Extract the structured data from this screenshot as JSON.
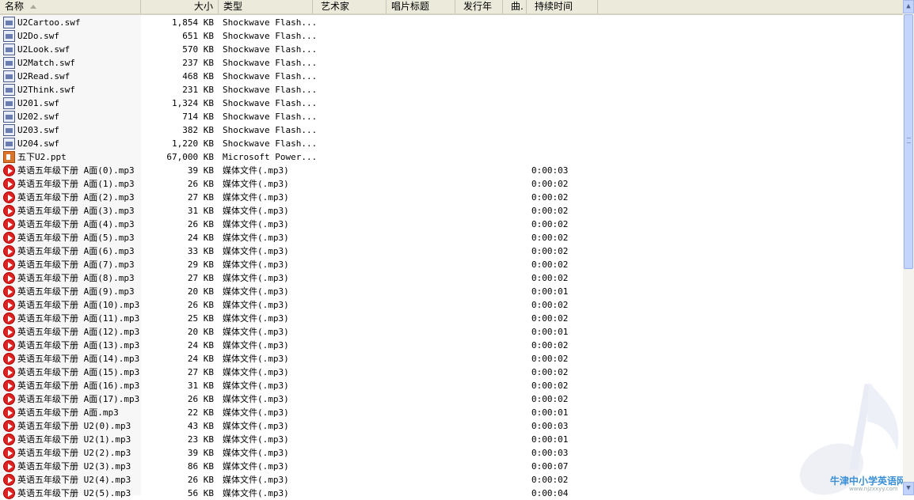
{
  "columns": {
    "name": "名称",
    "size": "大小",
    "type": "类型",
    "artist": "艺术家",
    "album": "唱片标题",
    "year": "发行年",
    "track": "曲.",
    "duration": "持续时间"
  },
  "sort": {
    "column": "name",
    "direction": "ascending"
  },
  "files": [
    {
      "name": "U2Cartoo.swf",
      "size": "1,854 KB",
      "type": "Shockwave Flash...",
      "duration": "",
      "icon": "swf-file-icon"
    },
    {
      "name": "U2Do.swf",
      "size": "651 KB",
      "type": "Shockwave Flash...",
      "duration": "",
      "icon": "swf-file-icon"
    },
    {
      "name": "U2Look.swf",
      "size": "570 KB",
      "type": "Shockwave Flash...",
      "duration": "",
      "icon": "swf-file-icon"
    },
    {
      "name": "U2Match.swf",
      "size": "237 KB",
      "type": "Shockwave Flash...",
      "duration": "",
      "icon": "swf-file-icon"
    },
    {
      "name": "U2Read.swf",
      "size": "468 KB",
      "type": "Shockwave Flash...",
      "duration": "",
      "icon": "swf-file-icon"
    },
    {
      "name": "U2Think.swf",
      "size": "231 KB",
      "type": "Shockwave Flash...",
      "duration": "",
      "icon": "swf-file-icon"
    },
    {
      "name": "U201.swf",
      "size": "1,324 KB",
      "type": "Shockwave Flash...",
      "duration": "",
      "icon": "swf-file-icon"
    },
    {
      "name": "U202.swf",
      "size": "714 KB",
      "type": "Shockwave Flash...",
      "duration": "",
      "icon": "swf-file-icon"
    },
    {
      "name": "U203.swf",
      "size": "382 KB",
      "type": "Shockwave Flash...",
      "duration": "",
      "icon": "swf-file-icon"
    },
    {
      "name": "U204.swf",
      "size": "1,220 KB",
      "type": "Shockwave Flash...",
      "duration": "",
      "icon": "swf-file-icon"
    },
    {
      "name": "五下U2.ppt",
      "size": "67,000 KB",
      "type": "Microsoft Power...",
      "duration": "",
      "icon": "ppt-file-icon"
    },
    {
      "name": "英语五年级下册 A面(0).mp3",
      "size": "39 KB",
      "type": "媒体文件(.mp3)",
      "duration": "0:00:03",
      "icon": "mp3-file-icon"
    },
    {
      "name": "英语五年级下册 A面(1).mp3",
      "size": "26 KB",
      "type": "媒体文件(.mp3)",
      "duration": "0:00:02",
      "icon": "mp3-file-icon"
    },
    {
      "name": "英语五年级下册 A面(2).mp3",
      "size": "27 KB",
      "type": "媒体文件(.mp3)",
      "duration": "0:00:02",
      "icon": "mp3-file-icon"
    },
    {
      "name": "英语五年级下册 A面(3).mp3",
      "size": "31 KB",
      "type": "媒体文件(.mp3)",
      "duration": "0:00:02",
      "icon": "mp3-file-icon"
    },
    {
      "name": "英语五年级下册 A面(4).mp3",
      "size": "26 KB",
      "type": "媒体文件(.mp3)",
      "duration": "0:00:02",
      "icon": "mp3-file-icon"
    },
    {
      "name": "英语五年级下册 A面(5).mp3",
      "size": "24 KB",
      "type": "媒体文件(.mp3)",
      "duration": "0:00:02",
      "icon": "mp3-file-icon"
    },
    {
      "name": "英语五年级下册 A面(6).mp3",
      "size": "33 KB",
      "type": "媒体文件(.mp3)",
      "duration": "0:00:02",
      "icon": "mp3-file-icon"
    },
    {
      "name": "英语五年级下册 A面(7).mp3",
      "size": "29 KB",
      "type": "媒体文件(.mp3)",
      "duration": "0:00:02",
      "icon": "mp3-file-icon"
    },
    {
      "name": "英语五年级下册 A面(8).mp3",
      "size": "27 KB",
      "type": "媒体文件(.mp3)",
      "duration": "0:00:02",
      "icon": "mp3-file-icon"
    },
    {
      "name": "英语五年级下册 A面(9).mp3",
      "size": "20 KB",
      "type": "媒体文件(.mp3)",
      "duration": "0:00:01",
      "icon": "mp3-file-icon"
    },
    {
      "name": "英语五年级下册 A面(10).mp3",
      "size": "26 KB",
      "type": "媒体文件(.mp3)",
      "duration": "0:00:02",
      "icon": "mp3-file-icon"
    },
    {
      "name": "英语五年级下册 A面(11).mp3",
      "size": "25 KB",
      "type": "媒体文件(.mp3)",
      "duration": "0:00:02",
      "icon": "mp3-file-icon"
    },
    {
      "name": "英语五年级下册 A面(12).mp3",
      "size": "20 KB",
      "type": "媒体文件(.mp3)",
      "duration": "0:00:01",
      "icon": "mp3-file-icon"
    },
    {
      "name": "英语五年级下册 A面(13).mp3",
      "size": "24 KB",
      "type": "媒体文件(.mp3)",
      "duration": "0:00:02",
      "icon": "mp3-file-icon"
    },
    {
      "name": "英语五年级下册 A面(14).mp3",
      "size": "24 KB",
      "type": "媒体文件(.mp3)",
      "duration": "0:00:02",
      "icon": "mp3-file-icon"
    },
    {
      "name": "英语五年级下册 A面(15).mp3",
      "size": "27 KB",
      "type": "媒体文件(.mp3)",
      "duration": "0:00:02",
      "icon": "mp3-file-icon"
    },
    {
      "name": "英语五年级下册 A面(16).mp3",
      "size": "31 KB",
      "type": "媒体文件(.mp3)",
      "duration": "0:00:02",
      "icon": "mp3-file-icon"
    },
    {
      "name": "英语五年级下册 A面(17).mp3",
      "size": "26 KB",
      "type": "媒体文件(.mp3)",
      "duration": "0:00:02",
      "icon": "mp3-file-icon"
    },
    {
      "name": "英语五年级下册 A面.mp3",
      "size": "22 KB",
      "type": "媒体文件(.mp3)",
      "duration": "0:00:01",
      "icon": "mp3-file-icon"
    },
    {
      "name": "英语五年级下册 U2(0).mp3",
      "size": "43 KB",
      "type": "媒体文件(.mp3)",
      "duration": "0:00:03",
      "icon": "mp3-file-icon"
    },
    {
      "name": "英语五年级下册 U2(1).mp3",
      "size": "23 KB",
      "type": "媒体文件(.mp3)",
      "duration": "0:00:01",
      "icon": "mp3-file-icon"
    },
    {
      "name": "英语五年级下册 U2(2).mp3",
      "size": "39 KB",
      "type": "媒体文件(.mp3)",
      "duration": "0:00:03",
      "icon": "mp3-file-icon"
    },
    {
      "name": "英语五年级下册 U2(3).mp3",
      "size": "86 KB",
      "type": "媒体文件(.mp3)",
      "duration": "0:00:07",
      "icon": "mp3-file-icon"
    },
    {
      "name": "英语五年级下册 U2(4).mp3",
      "size": "26 KB",
      "type": "媒体文件(.mp3)",
      "duration": "0:00:02",
      "icon": "mp3-file-icon"
    },
    {
      "name": "英语五年级下册 U2(5).mp3",
      "size": "56 KB",
      "type": "媒体文件(.mp3)",
      "duration": "0:00:04",
      "icon": "mp3-file-icon"
    }
  ],
  "watermark": {
    "title": "牛津中小学英语网",
    "url": "www.njzxxyy.com"
  }
}
